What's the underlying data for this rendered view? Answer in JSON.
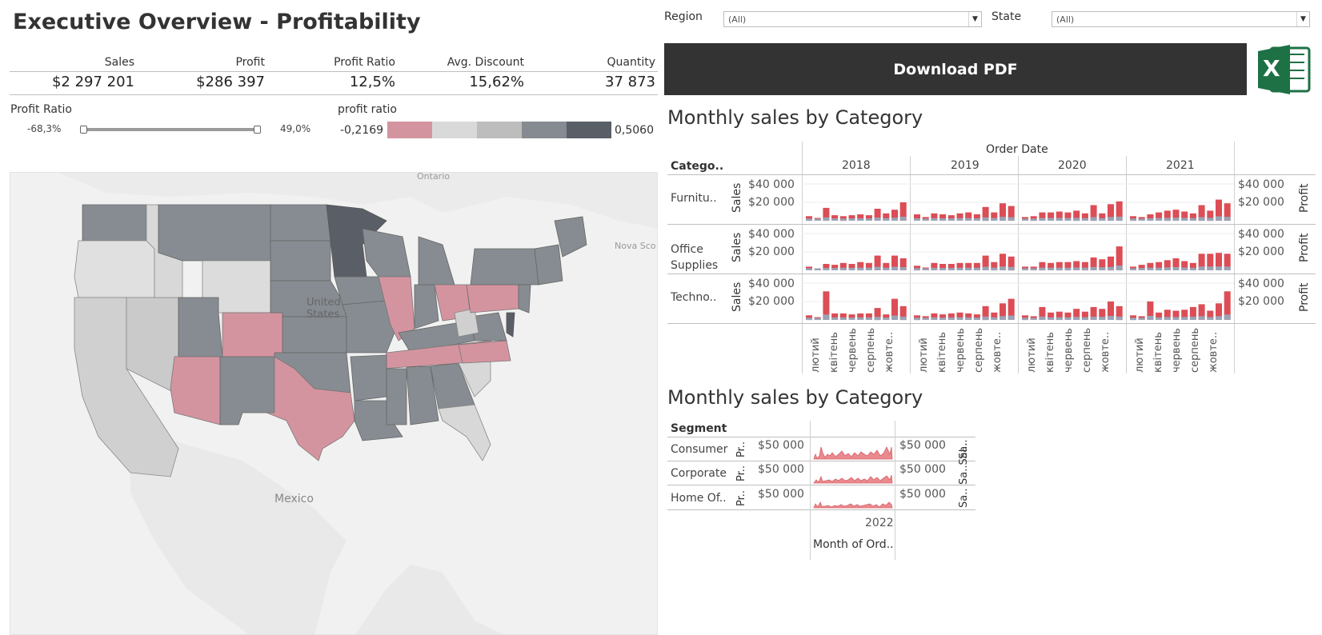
{
  "title": "Executive Overview - Profitability",
  "kpis": [
    {
      "label": "Sales",
      "value": "$2 297 201"
    },
    {
      "label": "Profit",
      "value": "$286 397"
    },
    {
      "label": "Profit Ratio",
      "value": "12,5%"
    },
    {
      "label": "Avg. Discount",
      "value": "15,62%"
    },
    {
      "label": "Quantity",
      "value": "37 873"
    }
  ],
  "profit_ratio_filter": {
    "label": "Profit Ratio",
    "min": "-68,3%",
    "max": "49,0%"
  },
  "profit_ratio_legend": {
    "label": "profit ratio",
    "min": "-0,2169",
    "max": "0,5060",
    "colors": [
      "#d4949f",
      "#d9d9d9",
      "#bdbdbd",
      "#858b90",
      "#5a5f67"
    ]
  },
  "filters": {
    "region": {
      "label": "Region",
      "value": "(All)"
    },
    "state": {
      "label": "State",
      "value": "(All)"
    }
  },
  "download_label": "Download PDF",
  "excel_icon_letter": "X",
  "map": {
    "labels": {
      "canada": "Ontario",
      "nova": "Nova Sco",
      "us": "United States",
      "mexico": "Mexico"
    }
  },
  "sales_chart": {
    "title": "Monthly sales by Category",
    "category_header": "Catego..",
    "order_date_header": "Order Date",
    "years": [
      "2018",
      "2019",
      "2020",
      "2021"
    ],
    "categories": [
      "Furnitu..",
      "Office Supplies",
      "Techno.."
    ],
    "measure_left": "Sales",
    "measure_right": "Profit",
    "tick_labels": [
      "$40 000",
      "$20 000"
    ],
    "month_labels": [
      "лютий",
      "квітень",
      "червень",
      "серпень",
      "жовте.."
    ]
  },
  "segment_chart": {
    "title": "Monthly sales by Category",
    "segment_header": "Segment",
    "segments": [
      "Consumer",
      "Corporate",
      "Home Of.."
    ],
    "left_axis": "Pr..",
    "right_axis": [
      "Sa..",
      "Sa..Sal..",
      "Sa.."
    ],
    "tick_label": "$50 000",
    "year": "2022",
    "x_header": "Month of Ord.."
  },
  "chart_data": [
    {
      "type": "bar",
      "title": "Monthly sales by Category",
      "x_label": "Order Date",
      "years": [
        "2018",
        "2019",
        "2020",
        "2021"
      ],
      "series": [
        {
          "name": "Furnitu..",
          "values": [
            5000,
            3000,
            14000,
            6000,
            5000,
            6000,
            7000,
            6000,
            13000,
            8000,
            12000,
            20000,
            7000,
            4000,
            8000,
            7000,
            6000,
            8000,
            9000,
            7000,
            15000,
            9000,
            19000,
            16000,
            4000,
            5000,
            9000,
            9000,
            10000,
            9000,
            11000,
            8000,
            17000,
            8000,
            18000,
            21000,
            5000,
            4000,
            7000,
            9000,
            11000,
            12000,
            10000,
            8000,
            17000,
            11000,
            23000,
            19000
          ]
        },
        {
          "name": "Office Supplies",
          "values": [
            4000,
            2000,
            7000,
            6000,
            8000,
            7000,
            9000,
            8000,
            16000,
            8000,
            16000,
            13000,
            5000,
            3000,
            8000,
            7000,
            7000,
            8000,
            8000,
            8000,
            16000,
            9000,
            18000,
            15000,
            4000,
            4000,
            9000,
            8000,
            9000,
            9000,
            10000,
            9000,
            14000,
            12000,
            15000,
            26000,
            4000,
            6000,
            8000,
            9000,
            11000,
            13000,
            10000,
            8000,
            18000,
            18000,
            19000,
            18000
          ]
        },
        {
          "name": "Techno..",
          "values": [
            5000,
            3000,
            31000,
            7000,
            7000,
            6000,
            7000,
            7000,
            13000,
            6000,
            23000,
            15000,
            5000,
            4000,
            7000,
            6000,
            7000,
            8000,
            7000,
            6000,
            15000,
            8000,
            18000,
            23000,
            5000,
            4000,
            14000,
            8000,
            9000,
            8000,
            12000,
            9000,
            14000,
            12000,
            20000,
            15000,
            5000,
            4000,
            20000,
            8000,
            11000,
            10000,
            11000,
            14000,
            17000,
            10000,
            18000,
            31000
          ]
        }
      ]
    },
    {
      "type": "area",
      "title": "Monthly sales by Category",
      "x_label": "Month of Ord..",
      "year": "2022",
      "series": [
        {
          "name": "Consumer"
        },
        {
          "name": "Corporate"
        },
        {
          "name": "Home Of.."
        }
      ]
    }
  ]
}
